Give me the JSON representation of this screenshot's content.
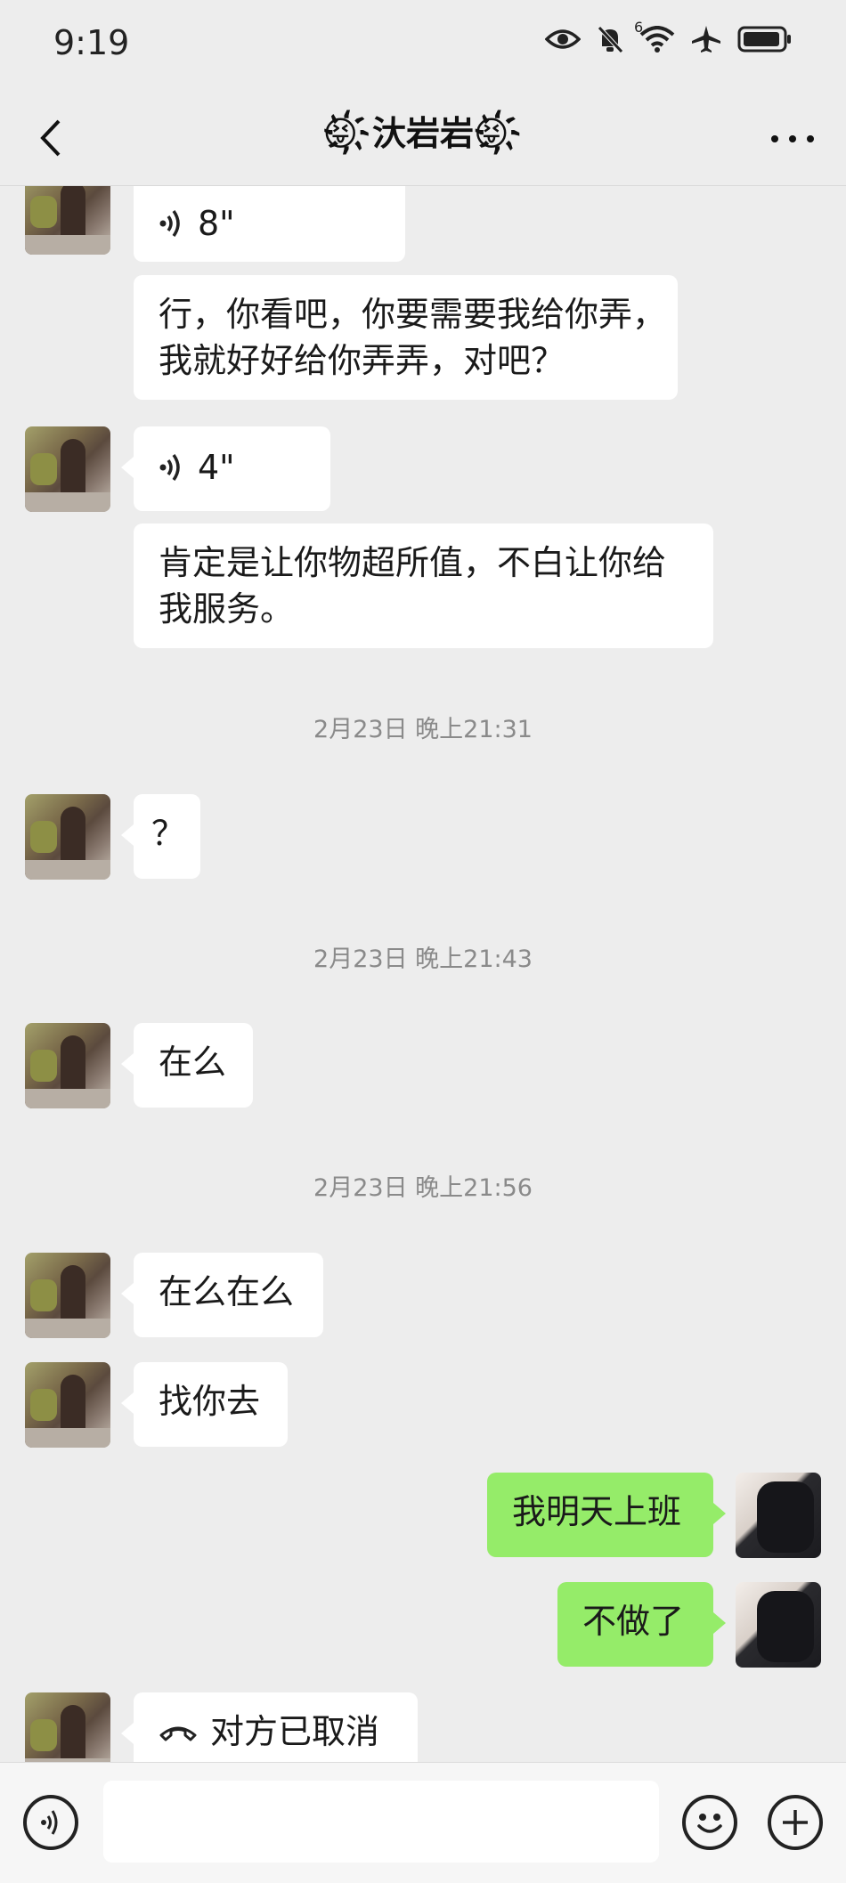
{
  "status": {
    "time": "9:19",
    "signal_label": "6"
  },
  "header": {
    "title": "😝҉汏岩岩😝҉"
  },
  "messages": [
    {
      "type": "voice",
      "text": "8\""
    },
    {
      "type": "text",
      "line1": "行，你看吧，你要需要我给你弄，",
      "line2": "我就好好给你弄弄，对吧？"
    },
    {
      "type": "voice",
      "text": "4\""
    },
    {
      "type": "text",
      "line1": "肯定是让你物超所值，不白让你给",
      "line2": "我服务。"
    },
    {
      "type": "timestamp",
      "text": "2月23日 晚上21:31"
    },
    {
      "type": "text",
      "text": "？"
    },
    {
      "type": "timestamp",
      "text": "2月23日 晚上21:43"
    },
    {
      "type": "text",
      "text": "在么"
    },
    {
      "type": "timestamp",
      "text": "2月23日 晚上21:56"
    },
    {
      "type": "text",
      "text": "在么在么"
    },
    {
      "type": "text",
      "text": "找你去"
    },
    {
      "type": "text",
      "sender": "me",
      "text": "我明天上班"
    },
    {
      "type": "text",
      "sender": "me",
      "text": "不做了"
    },
    {
      "type": "call",
      "text": "对方已取消"
    }
  ],
  "colors": {
    "background": "#ededed",
    "bubble_other": "#ffffff",
    "bubble_me": "#95ec69",
    "timestamp": "#8a8a8a"
  },
  "icons": [
    "eye-icon",
    "mute-bell-icon",
    "wifi-icon",
    "airplane-icon",
    "battery-icon",
    "back-arrow-icon",
    "more-icon",
    "voice-icon",
    "call-cancel-icon",
    "voice-input-icon",
    "emoji-icon",
    "plus-icon"
  ]
}
